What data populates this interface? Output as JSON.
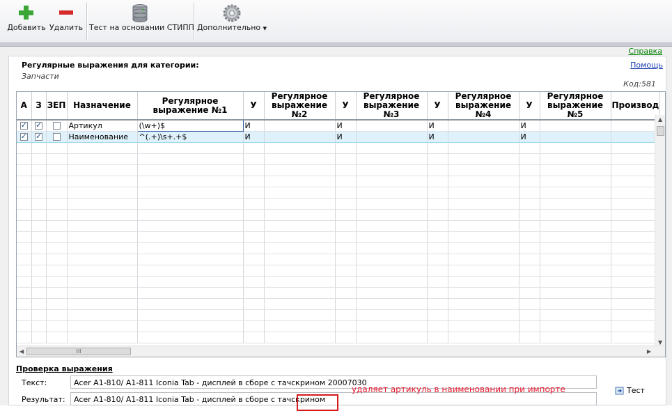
{
  "toolbar": {
    "add_label": "Добавить",
    "delete_label": "Удалить",
    "test_label": "Тест на основании СТИПП",
    "more_label": "Дополнительно"
  },
  "help": "Справка",
  "panel": {
    "title": "Регулярные выражения для категории:",
    "category": "Запчасти",
    "aid_link": "Помощь",
    "code": "Код:581"
  },
  "grid": {
    "headers": [
      "А",
      "З",
      "ЗЕП",
      "Назначение",
      "Регулярное выражение №1",
      "У",
      "Регулярное выражение №2",
      "У",
      "Регулярное выражение №3",
      "У",
      "Регулярное выражение №4",
      "У",
      "Регулярное выражение №5",
      "Производ"
    ],
    "rows": [
      {
        "a": true,
        "z": true,
        "zep": false,
        "purpose": "Артикул",
        "re1": "(\\w+)$",
        "u1": "И",
        "re2": "",
        "u2": "И",
        "re3": "",
        "u3": "И",
        "re4": "",
        "u4": "И",
        "re5": "",
        "prod": ""
      },
      {
        "a": true,
        "z": true,
        "zep": false,
        "purpose": "Наименование",
        "re1": "^(.+)\\s+.+$",
        "u1": "И",
        "re2": "",
        "u2": "И",
        "re3": "",
        "u3": "И",
        "re4": "",
        "u4": "И",
        "re5": "",
        "prod": ""
      }
    ],
    "hscroll_thumb": "III"
  },
  "check": {
    "title": "Проверка выражения",
    "text_label": "Текст:",
    "text_value": "Acer A1-810/ A1-811 Iconia Tab - дисплей в сборе с тачскрином 20007030",
    "result_label": "Результат:",
    "result_value": "Acer A1-810/ A1-811 Iconia Tab - дисплей в сборе с тачскрином",
    "test_button": "Тест"
  },
  "annotation": "удаляет артикуль в наименовании при импорте",
  "colors": {
    "add": "#3aa635",
    "delete": "#d42a2a",
    "help_link": "#008000",
    "annotation": "#e8182d",
    "selected_row": "#dff2fb"
  }
}
